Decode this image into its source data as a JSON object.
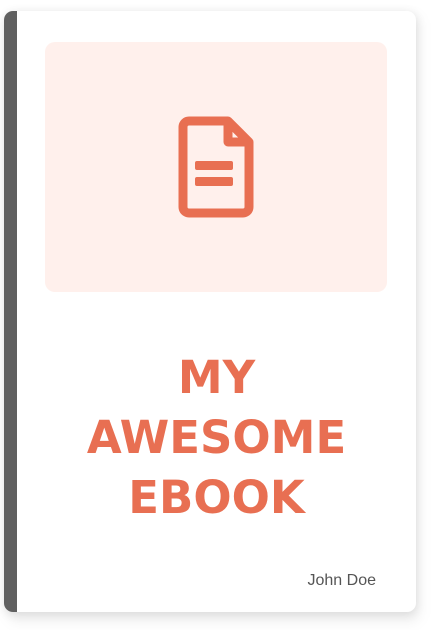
{
  "book": {
    "title_lines": [
      "MY",
      "AWESOME",
      "EBOOK"
    ],
    "author": "John Doe"
  },
  "colors": {
    "accent": "#e86f52",
    "art_background": "#fff0ec",
    "spine": "#606060",
    "author_text": "#555555"
  },
  "icons": {
    "cover": "document-icon"
  }
}
